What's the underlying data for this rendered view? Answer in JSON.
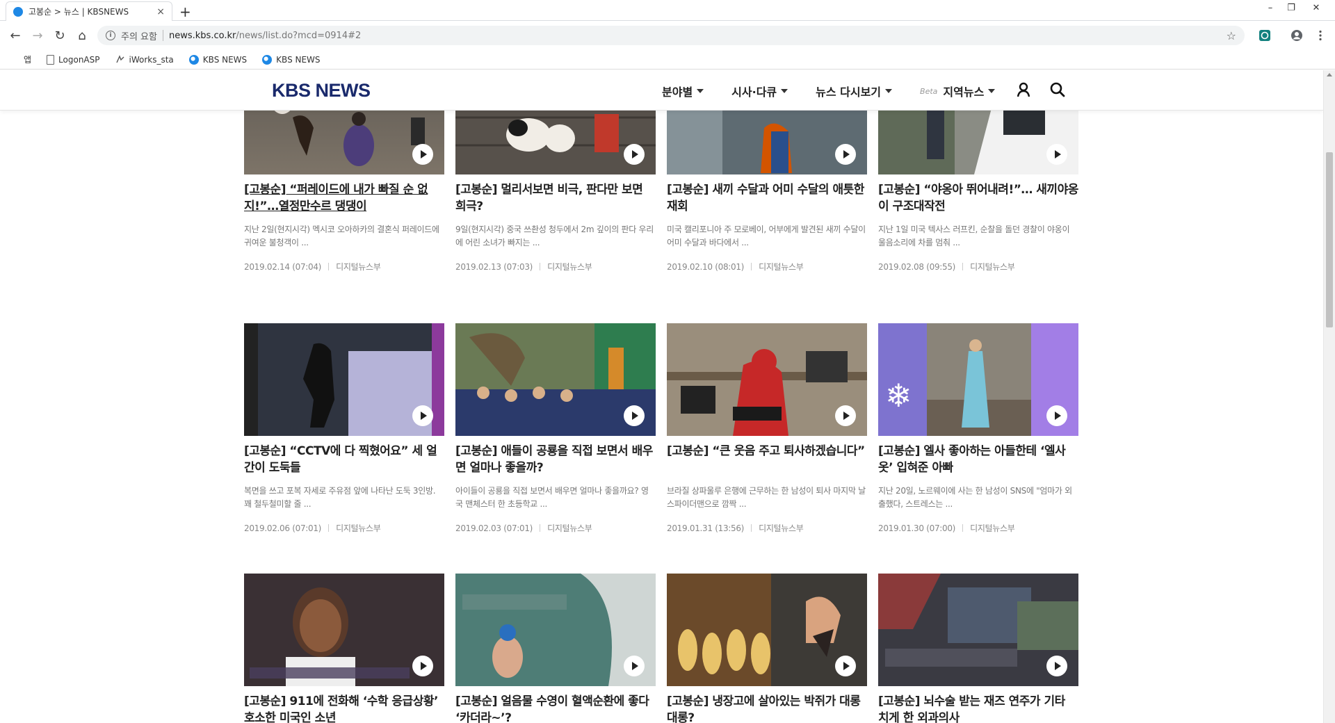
{
  "browser": {
    "tab_title": "고봉순 > 뉴스 | KBSNEWS",
    "tab_close": "×",
    "new_tab": "+",
    "win_min": "–",
    "win_restore": "❐",
    "win_close": "✕",
    "nav_back": "←",
    "nav_forward": "→",
    "nav_reload": "↻",
    "nav_home": "⌂",
    "security_info": "i",
    "security_text": "주의 요함",
    "url_host": "news.kbs.co.kr",
    "url_path": "/news/list.do?mcd=0914#2",
    "bookmark_star": "☆",
    "bookmarks": [
      {
        "label": "앱"
      },
      {
        "label": "LogonASP"
      },
      {
        "label": "iWorks_sta"
      },
      {
        "label": "KBS NEWS"
      },
      {
        "label": "KBS NEWS"
      }
    ]
  },
  "site": {
    "logo": "KBS NEWS",
    "menu": [
      {
        "label": "분야별"
      },
      {
        "label": "시사·다큐"
      },
      {
        "label": "뉴스 다시보기"
      },
      {
        "label": "지역뉴스",
        "badge": "Beta"
      }
    ]
  },
  "articles": [
    {
      "title": "[고봉순] “퍼레이드에 내가 빠질 순 없지!”…열정만수르 댕댕이",
      "desc": "지난 2일(현지시각) 멕시코 오아하카의 결혼식 퍼레이드에 귀여운 불청객이 ...",
      "date": "2019.02.14 (07:04)",
      "author": "디지털뉴스부"
    },
    {
      "title": "[고봉순] 멀리서보면 비극, 판다만 보면 희극?",
      "desc": "9일(현지시각) 중국 쓰촨성 청두에서 2m 깊이의 판다 우리에 어린 소녀가 빠지는 ...",
      "date": "2019.02.13 (07:03)",
      "author": "디지털뉴스부"
    },
    {
      "title": "[고봉순] 새끼 수달과 어미 수달의 애틋한 재회",
      "desc": "미국 캘리포니아 주 모로베이, 어부에게 발견된 새끼 수달이 어미 수달과 바다에서 ...",
      "date": "2019.02.10 (08:01)",
      "author": "디지털뉴스부"
    },
    {
      "title": "[고봉순] “야옹아 뛰어내려!”… 새끼야옹이 구조대작전",
      "desc": "지난 1일 미국 텍사스 러프킨, 순찰을 돌던 경찰이 야옹이 울음소리에 차를 멈춰 ...",
      "date": "2019.02.08 (09:55)",
      "author": "디지털뉴스부"
    },
    {
      "title": "[고봉순] “CCTV에 다 찍혔어요” 세 얼간이 도둑들",
      "desc": "복면을 쓰고 포복 자세로 주유점 앞에 나타난 도둑 3인방. 꽤 철두철미할 줄 ...",
      "date": "2019.02.06 (07:01)",
      "author": "디지털뉴스부"
    },
    {
      "title": "[고봉순] 애들이 공룡을 직접 보면서 배우면 얼마나 좋을까?",
      "desc": "아이들이 공룡을 직접 보면서 배우면 얼마나 좋을까요? 영국 맨체스터 한 초등학교 ...",
      "date": "2019.02.03 (07:01)",
      "author": "디지털뉴스부"
    },
    {
      "title": "[고봉순] “큰 웃음 주고 퇴사하겠습니다”",
      "desc": "브라질 상파울루 은행에 근무하는 한 남성이 퇴사 마지막 날 스파이더맨으로 깜짝 ...",
      "date": "2019.01.31 (13:56)",
      "author": "디지털뉴스부"
    },
    {
      "title": "[고봉순] 엘사 좋아하는 아들한테 ‘엘사 옷’ 입혀준 아빠",
      "desc": "지난 20일, 노르웨이에 사는 한 남성이 SNS에 \"엄마가 외출했다, 스트레스는 ...",
      "date": "2019.01.30 (07:00)",
      "author": "디지털뉴스부"
    },
    {
      "title": "[고봉순] 911에 전화해 ‘수학 응급상황’ 호소한 미국인 소년",
      "desc": "",
      "date": "",
      "author": ""
    },
    {
      "title": "[고봉순] 얼음물 수영이 혈액순환에 좋다 ‘카더라~’?",
      "desc": "",
      "date": "",
      "author": ""
    },
    {
      "title": "[고봉순] 냉장고에 살아있는 박쥐가 대롱대롱?",
      "desc": "",
      "date": "",
      "author": ""
    },
    {
      "title": "[고봉순] 뇌수술 받는 재즈 연주가 기타 치게 한 외과의사",
      "desc": "",
      "date": "",
      "author": ""
    }
  ]
}
